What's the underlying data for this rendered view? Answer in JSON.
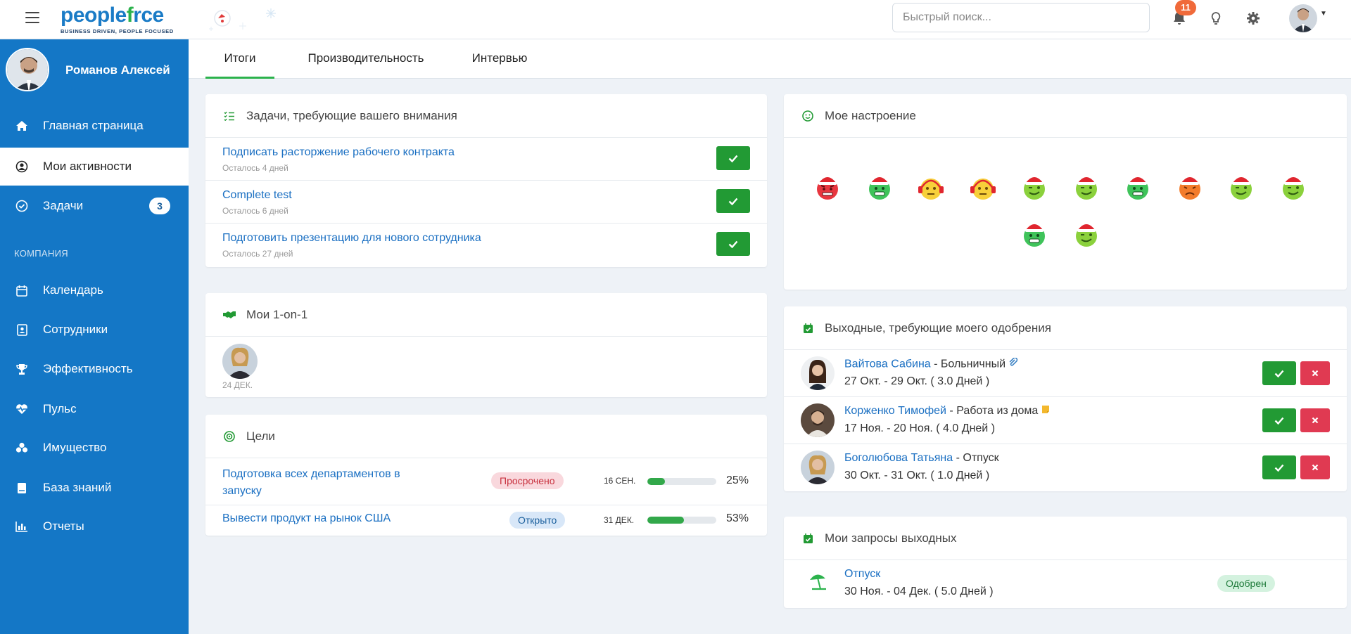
{
  "app": {
    "logo_main_a": "people",
    "logo_main_b": "f",
    "logo_main_c": "rce",
    "logo_sub": "BUSINESS DRIVEN, PEOPLE FOCUSED"
  },
  "topbar": {
    "search_placeholder": "Быстрый поиск...",
    "notifications_count": "11"
  },
  "sidebar": {
    "user_name": "Романов Алексей",
    "section_company": "КОМПАНИЯ",
    "items": [
      {
        "label": "Главная страница",
        "icon": "home-icon"
      },
      {
        "label": "Мои активности",
        "icon": "user-circle-icon"
      },
      {
        "label": "Задачи",
        "icon": "check-circle-icon",
        "badge": "3"
      },
      {
        "label": "Календарь",
        "icon": "calendar-icon"
      },
      {
        "label": "Сотрудники",
        "icon": "id-card-icon"
      },
      {
        "label": "Эффективность",
        "icon": "trophy-icon"
      },
      {
        "label": "Пульс",
        "icon": "heartbeat-icon"
      },
      {
        "label": "Имущество",
        "icon": "cubes-icon"
      },
      {
        "label": "База знаний",
        "icon": "book-icon"
      },
      {
        "label": "Отчеты",
        "icon": "bar-chart-icon"
      }
    ]
  },
  "tabs": [
    {
      "label": "Итоги",
      "active": true
    },
    {
      "label": "Производительность",
      "active": false
    },
    {
      "label": "Интервью",
      "active": false
    }
  ],
  "tasks_card": {
    "title": "Задачи, требующие вашего внимания",
    "items": [
      {
        "title": "Подписать расторжение рабочего контракта",
        "sub": "Осталось 4 дней"
      },
      {
        "title": "Complete test",
        "sub": "Осталось 6 дней"
      },
      {
        "title": "Подготовить презентацию для нового сотрудника",
        "sub": "Осталось 27 дней"
      }
    ]
  },
  "oneonone_card": {
    "title": "Мои 1-on-1",
    "date": "24 ДЕК."
  },
  "goals_card": {
    "title": "Цели",
    "items": [
      {
        "title_line1": "Подготовка всех департаментов в",
        "title_line2": "запуску",
        "status": "Просрочено",
        "date": "16 СЕН.",
        "progress": 25,
        "progress_label": "25%"
      },
      {
        "title_line1": "Вывести продукт на рынок США",
        "title_line2": "",
        "status": "Открыто",
        "date": "31 ДЕК.",
        "progress": 53,
        "progress_label": "53%"
      }
    ]
  },
  "mood_card": {
    "title": "Мое настроение",
    "moods": [
      "angry-santa",
      "happy-santa",
      "neutral-headphones",
      "neutral-headphones",
      "wink-santa",
      "wink-santa",
      "happy-santa",
      "sad-santa",
      "wink-santa",
      "wink-santa",
      "happy-santa",
      "wink-santa"
    ]
  },
  "approvals_card": {
    "title": "Выходные, требующие моего одобрения",
    "items": [
      {
        "name": "Вайтова Сабина",
        "type": " - Больничный",
        "dates": "27 Окт. - 29 Окт. ( 3.0 Дней )"
      },
      {
        "name": "Корженко Тимофей",
        "type": " - Работа из дома",
        "dates": "17 Ноя. - 20 Ноя. ( 4.0 Дней )"
      },
      {
        "name": "Боголюбова Татьяна",
        "type": " - Отпуск",
        "dates": "30 Окт. - 31 Окт. ( 1.0 Дней )"
      }
    ]
  },
  "requests_card": {
    "title": "Мои запросы выходных",
    "items": [
      {
        "name": "Отпуск",
        "dates": "30 Ноя. - 04 Дек. ( 5.0 Дней )",
        "status": "Одобрен"
      }
    ]
  },
  "colors": {
    "sidebar": "#1477c6",
    "accent_green": "#229a34",
    "danger": "#e03a52",
    "link": "#1a6fc2"
  }
}
